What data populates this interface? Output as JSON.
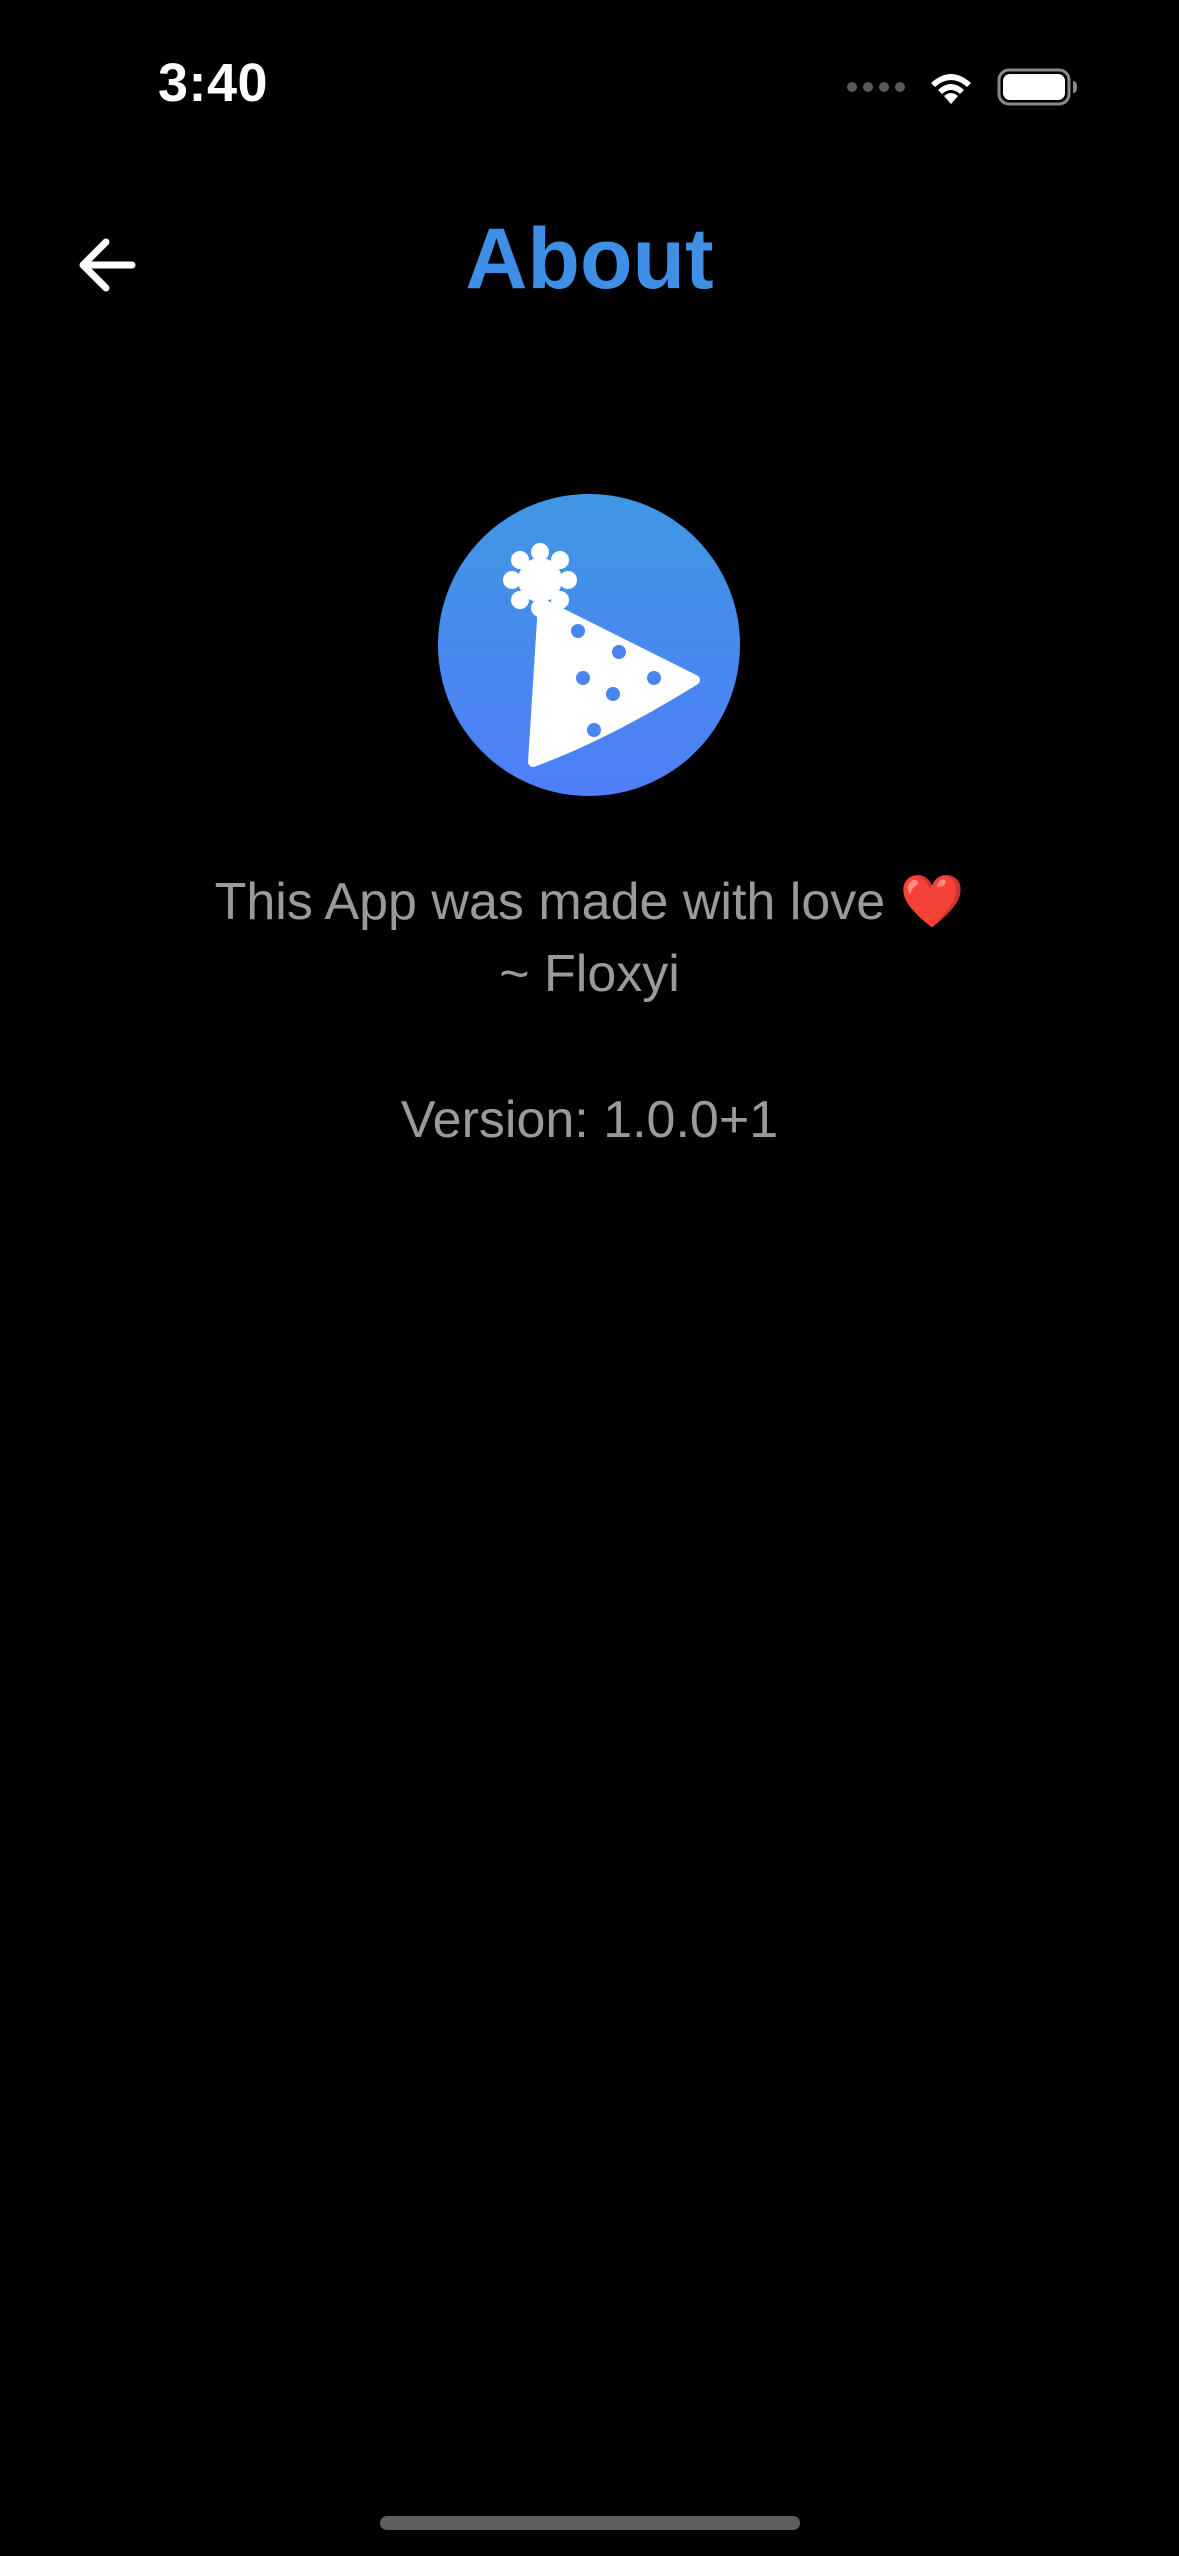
{
  "status_bar": {
    "time": "3:40"
  },
  "header": {
    "title": "About",
    "back_icon": "arrow-left-icon"
  },
  "logo": {
    "icon": "party-hat-icon"
  },
  "credits": {
    "line1": "This App was made with love",
    "heart": "❤️",
    "line2": "~ Floxyi"
  },
  "version": {
    "label": "Version:",
    "value": "1.0.0+1"
  },
  "colors": {
    "background": "#000000",
    "accent": "#3f8fe6",
    "logo_gradient_top": "#3f97e3",
    "logo_gradient_bottom": "#4f7ef8",
    "secondary_text": "#9a9a9a"
  }
}
